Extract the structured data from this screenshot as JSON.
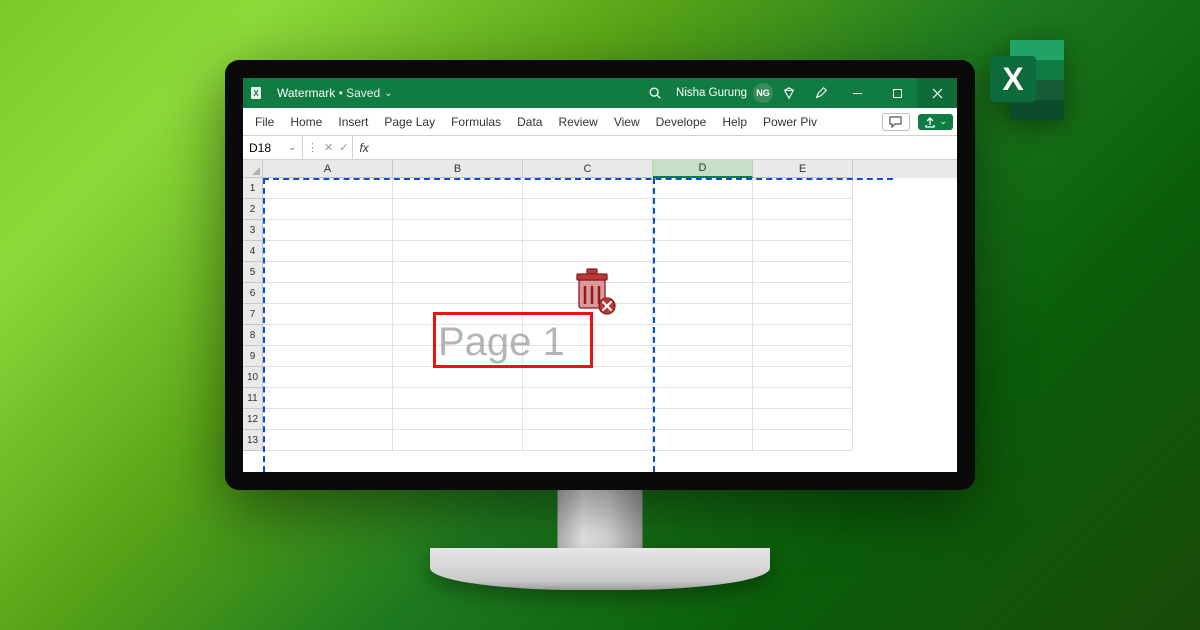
{
  "titlebar": {
    "doc_name": "Watermark",
    "saved_status": "Saved",
    "user_name": "Nisha Gurung",
    "user_initials": "NG"
  },
  "ribbon": [
    "File",
    "Home",
    "Insert",
    "Page Lay",
    "Formulas",
    "Data",
    "Review",
    "View",
    "Develope",
    "Help",
    "Power Piv"
  ],
  "namebox": {
    "ref": "D18",
    "fx_label": "fx"
  },
  "grid": {
    "columns": [
      "A",
      "B",
      "C",
      "D",
      "E"
    ],
    "active_column": "D",
    "rows": [
      "1",
      "2",
      "3",
      "4",
      "5",
      "6",
      "7",
      "8",
      "9",
      "10",
      "11",
      "12",
      "13"
    ],
    "watermark_text": "Page 1"
  },
  "logo": {
    "letter": "X"
  }
}
